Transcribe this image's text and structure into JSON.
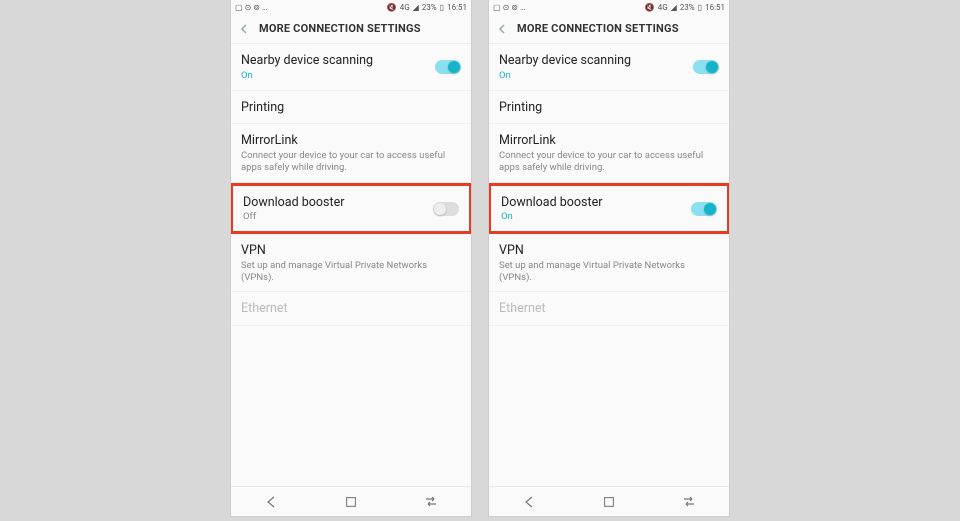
{
  "status": {
    "left_icons": [
      "image-icon",
      "clock-icon",
      "whatsapp-icon",
      "more-icon"
    ],
    "mute": "mute",
    "signal": "4G",
    "battery": "23%",
    "time": "16:51"
  },
  "header": {
    "title": "MORE CONNECTION SETTINGS"
  },
  "rows": {
    "nearby": {
      "title": "Nearby device scanning",
      "sub": "On"
    },
    "printing": {
      "title": "Printing"
    },
    "mirrorlink": {
      "title": "MirrorLink",
      "sub": "Connect your device to your car to access useful apps safely while driving."
    },
    "download_off": {
      "title": "Download booster",
      "sub": "Off"
    },
    "download_on": {
      "title": "Download booster",
      "sub": "On"
    },
    "vpn": {
      "title": "VPN",
      "sub": "Set up and manage Virtual Private Networks (VPNs)."
    },
    "ethernet": {
      "title": "Ethernet"
    }
  }
}
